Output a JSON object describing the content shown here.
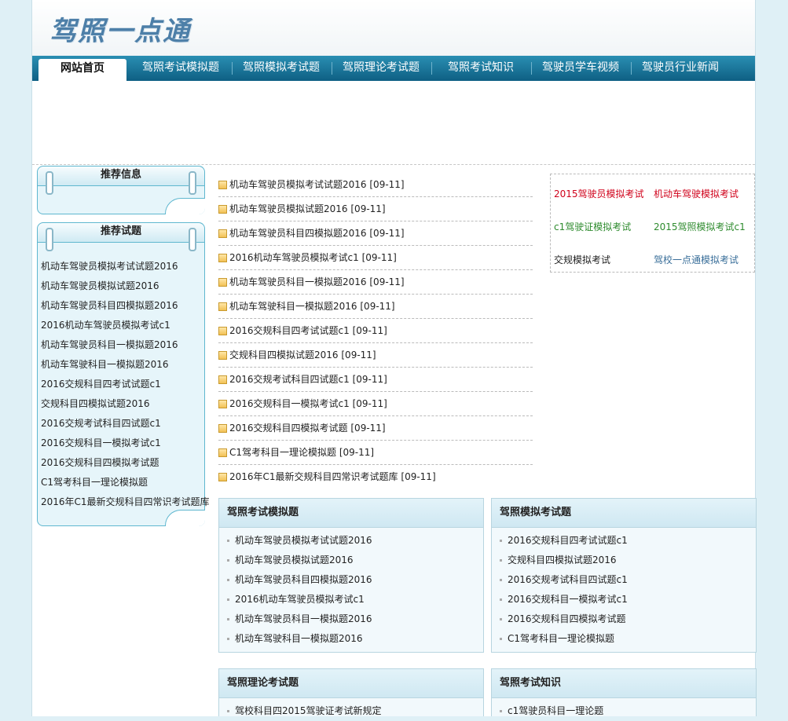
{
  "site": {
    "logo_text": "驾照一点通"
  },
  "nav": [
    "网站首页",
    "驾照考试模拟题",
    "驾照模拟考试题",
    "驾照理论考试题",
    "驾照考试知识",
    "驾驶员学车视频",
    "驾驶员行业新闻"
  ],
  "sidebar": {
    "recommend_info": {
      "title": "推荐信息"
    },
    "recommend_questions": {
      "title": "推荐试题",
      "items": [
        "机动车驾驶员模拟考试试题2016",
        "机动车驾驶员模拟试题2016",
        "机动车驾驶员科目四模拟题2016",
        "2016机动车驾驶员模拟考试c1",
        "机动车驾驶员科目一模拟题2016",
        "机动车驾驶科目一模拟题2016",
        "2016交规科目四考试试题c1",
        "交规科目四模拟试题2016",
        "2016交规考试科目四试题c1",
        "2016交规科目一模拟考试c1",
        "2016交规科目四模拟考试题",
        "C1驾考科目一理论模拟题",
        "2016年C1最新交规科目四常识考试题库"
      ]
    }
  },
  "main_list": [
    {
      "title": "机动车驾驶员模拟考试试题2016",
      "date": "[09-11]"
    },
    {
      "title": "机动车驾驶员模拟试题2016",
      "date": "[09-11]"
    },
    {
      "title": "机动车驾驶员科目四模拟题2016",
      "date": "[09-11]"
    },
    {
      "title": "2016机动车驾驶员模拟考试c1",
      "date": "[09-11]"
    },
    {
      "title": "机动车驾驶员科目一模拟题2016",
      "date": "[09-11]"
    },
    {
      "title": "机动车驾驶科目一模拟题2016",
      "date": "[09-11]"
    },
    {
      "title": "2016交规科目四考试试题c1",
      "date": "[09-11]"
    },
    {
      "title": "交规科目四模拟试题2016",
      "date": "[09-11]"
    },
    {
      "title": "2016交规考试科目四试题c1",
      "date": "[09-11]"
    },
    {
      "title": "2016交规科目一模拟考试c1",
      "date": "[09-11]"
    },
    {
      "title": "2016交规科目四模拟考试题",
      "date": "[09-11]"
    },
    {
      "title": "C1驾考科目一理论模拟题",
      "date": "[09-11]"
    },
    {
      "title": "2016年C1最新交规科目四常识考试题库",
      "date": "[09-11]"
    }
  ],
  "right_links": [
    {
      "text": "2015驾驶员模拟考试",
      "color": "#d0021b"
    },
    {
      "text": "机动车驾驶模拟考试",
      "color": "#d0021b"
    },
    {
      "text": "c1驾驶证模拟考试",
      "color": "#2e8b2e"
    },
    {
      "text": "2015驾照模拟考试c1",
      "color": "#2e8b2e"
    },
    {
      "text": "交规模拟考试",
      "color": "#222222"
    },
    {
      "text": "驾校一点通模拟考试",
      "color": "#3a6f9a"
    }
  ],
  "panels": [
    {
      "title": "驾照考试模拟题",
      "items": [
        "机动车驾驶员模拟考试试题2016",
        "机动车驾驶员模拟试题2016",
        "机动车驾驶员科目四模拟题2016",
        "2016机动车驾驶员模拟考试c1",
        "机动车驾驶员科目一模拟题2016",
        "机动车驾驶科目一模拟题2016"
      ]
    },
    {
      "title": "驾照模拟考试题",
      "items": [
        "2016交规科目四考试试题c1",
        "交规科目四模拟试题2016",
        "2016交规考试科目四试题c1",
        "2016交规科目一模拟考试c1",
        "2016交规科目四模拟考试题",
        "C1驾考科目一理论模拟题"
      ]
    },
    {
      "title": "驾照理论考试题",
      "items": [
        "驾校科目四2015驾驶证考试新规定"
      ]
    },
    {
      "title": "驾照考试知识",
      "items": [
        "c1驾驶员科目一理论题"
      ]
    }
  ]
}
